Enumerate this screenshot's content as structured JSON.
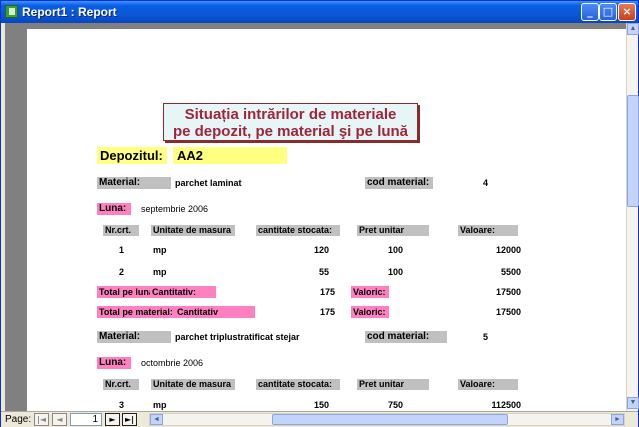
{
  "window": {
    "title": "Report1 : Report",
    "minimize_label": "_",
    "maximize_label": "□",
    "close_label": "×"
  },
  "report": {
    "title_line1": "Situația intrărilor de materiale",
    "title_line2": "pe depozit, pe material şi pe lună",
    "depozit_label": "Depozitul:",
    "depozit_value": "AA2",
    "material_label": "Material:",
    "cod_material_label": "cod material:",
    "luna_label": "Luna:",
    "columns": {
      "nr": "Nr.crt.",
      "unitate": "Unitate de masura",
      "cantitate": "cantitate stocata:",
      "pret": "Pret unitar",
      "valoare": "Valoare:"
    },
    "total_luna_label": "Total pe luna:",
    "cantitativ_label": "Cantitativ:",
    "total_material_label": "Total pe material:",
    "cantitativ_label2": "Cantitativ",
    "valoric_label": "Valoric:",
    "groups": [
      {
        "material": "parchet laminat",
        "cod_material": "4",
        "luna": "septembrie 2006",
        "rows": [
          {
            "nr": "1",
            "unitate": "mp",
            "cantitate": "120",
            "pret": "100",
            "valoare": "12000"
          },
          {
            "nr": "2",
            "unitate": "mp",
            "cantitate": "55",
            "pret": "100",
            "valoare": "5500"
          }
        ],
        "total_luna_cantitativ": "175",
        "total_luna_valoric": "17500",
        "total_material_cantitativ": "175",
        "total_material_valoric": "17500"
      },
      {
        "material": "parchet triplustratificat stejar",
        "cod_material": "5",
        "luna": "octombrie 2006",
        "rows": [
          {
            "nr": "3",
            "unitate": "mp",
            "cantitate": "150",
            "pret": "750",
            "valoare": "112500"
          }
        ]
      }
    ]
  },
  "statusbar": {
    "page_label": "Page:",
    "page_number": "1",
    "first_glyph": "|◄",
    "prev_glyph": "◄",
    "next_glyph": "►",
    "last_glyph": "►|"
  },
  "colors": {
    "title_text": "#a3243a",
    "title_bg": "#e6f6f6",
    "depozit_bg": "#ffff80",
    "label_gray": "#c0c0c0",
    "label_pink": "#ff80c0"
  }
}
